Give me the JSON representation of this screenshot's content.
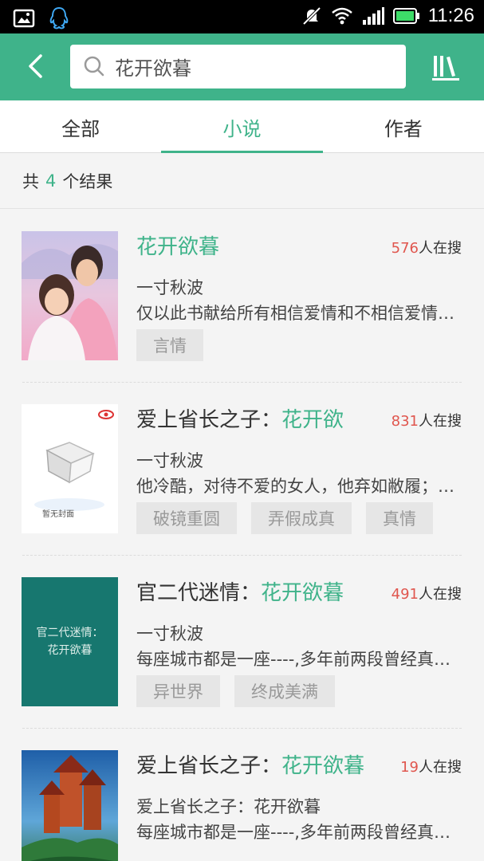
{
  "status_bar": {
    "time": "11:26"
  },
  "search": {
    "value": "花开欲暮"
  },
  "tabs": [
    {
      "label": "全部"
    },
    {
      "label": "小说",
      "active": true
    },
    {
      "label": "作者"
    }
  ],
  "result_count": {
    "prefix": "共",
    "count": "4",
    "suffix": "个结果"
  },
  "books": [
    {
      "title_plain": "",
      "title_highlight": "花开欲暮",
      "readers_count": "576",
      "readers_suffix": "人在搜",
      "author": "一寸秋波",
      "description": "仅以此书献给所有相信爱情和不相信爱情的人",
      "tags": [
        "言情"
      ],
      "cover_kind": "photo-couple"
    },
    {
      "title_plain": "爱上省长之子：",
      "title_highlight": "花开欲",
      "readers_count": "831",
      "readers_suffix": "人在搜",
      "author": "一寸秋波",
      "description": "他冷酷，对待不爱的女人，他弃如敝履；对待",
      "tags": [
        "破镜重圆",
        "弄假成真",
        "真情"
      ],
      "cover_kind": "no-cover",
      "cover_text": "暂无封面"
    },
    {
      "title_plain": "官二代迷情：",
      "title_highlight": "花开欲暮",
      "readers_count": "491",
      "readers_suffix": "人在搜",
      "author": "一寸秋波",
      "description": "每座城市都是一座----,多年前两段曾经真挚的",
      "tags": [
        "异世界",
        "终成美满"
      ],
      "cover_kind": "text-cover",
      "cover_text_line1": "官二代迷情：",
      "cover_text_line2": "花开欲暮",
      "cover_color": "#17776f"
    },
    {
      "title_plain": "爱上省长之子：",
      "title_highlight": "花开欲暮",
      "readers_count": "19",
      "readers_suffix": "人在搜",
      "author": "爱上省长之子：花开欲暮",
      "description": "每座城市都是一座----,多年前两段曾经真挚的",
      "tags": [],
      "cover_kind": "painting-castle"
    }
  ],
  "colors": {
    "accent": "#3fb38a",
    "readers_count": "#e0564e",
    "statusbar": "#000000"
  }
}
